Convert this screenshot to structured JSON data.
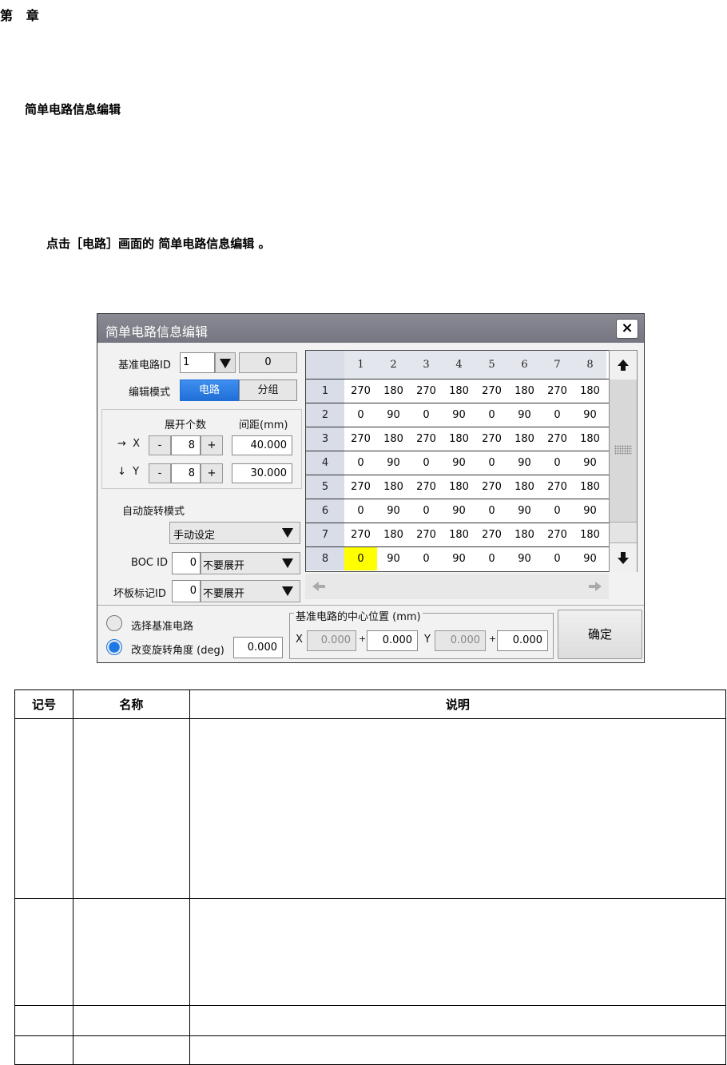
{
  "chapter": {
    "prefix": "第",
    "suffix": "章"
  },
  "section_title": "简单电路信息编辑",
  "instruction": {
    "lead": "点击［电路］画面的",
    "target": "简单电路信息编辑",
    "end": "。"
  },
  "dialog": {
    "title": "简单电路信息编辑",
    "close_symbol": "×",
    "base_circuit_label": "基准电路ID",
    "base_circuit_value": "1",
    "base_circuit_extra": "0",
    "edit_mode_label": "编辑模式",
    "edit_mode_options": [
      "电路",
      "分组"
    ],
    "expand_count_label": "展开个数",
    "spacing_label": "间距(mm)",
    "x_arrow": "→",
    "x_label": "X",
    "x_count": "8",
    "x_spacing": "40.000",
    "y_arrow": "↓",
    "y_label": "Y",
    "y_count": "8",
    "y_spacing": "30.000",
    "minus": "-",
    "plus": "+",
    "auto_rotate_label": "自动旋转模式",
    "auto_rotate_value": "手动设定",
    "boc_label": "BOC ID",
    "boc_value": "0",
    "boc_option": "不要展开",
    "bad_mark_label": "坏板标记ID",
    "bad_mark_value": "0",
    "bad_mark_option": "不要展开",
    "radio_select_base": "选择基准电路",
    "radio_change_angle": "改变旋转角度 (deg)",
    "angle_value": "0.000",
    "center_group_label": "基准电路的中心位置 (mm)",
    "center_x_label": "X",
    "center_x_base": "0.000",
    "center_x_offset": "0.000",
    "center_y_label": "Y",
    "center_y_base": "0.000",
    "center_y_offset": "0.000",
    "plus_small": "+",
    "confirm_label": "确定",
    "grid": {
      "columns": [
        "1",
        "2",
        "3",
        "4",
        "5",
        "6",
        "7",
        "8"
      ],
      "rows": [
        {
          "label": "1",
          "cells": [
            "270",
            "180",
            "270",
            "180",
            "270",
            "180",
            "270",
            "180"
          ]
        },
        {
          "label": "2",
          "cells": [
            "0",
            "90",
            "0",
            "90",
            "0",
            "90",
            "0",
            "90"
          ]
        },
        {
          "label": "3",
          "cells": [
            "270",
            "180",
            "270",
            "180",
            "270",
            "180",
            "270",
            "180"
          ]
        },
        {
          "label": "4",
          "cells": [
            "0",
            "90",
            "0",
            "90",
            "0",
            "90",
            "0",
            "90"
          ]
        },
        {
          "label": "5",
          "cells": [
            "270",
            "180",
            "270",
            "180",
            "270",
            "180",
            "270",
            "180"
          ]
        },
        {
          "label": "6",
          "cells": [
            "0",
            "90",
            "0",
            "90",
            "0",
            "90",
            "0",
            "90"
          ]
        },
        {
          "label": "7",
          "cells": [
            "270",
            "180",
            "270",
            "180",
            "270",
            "180",
            "270",
            "180"
          ]
        },
        {
          "label": "8",
          "cells": [
            "0",
            "90",
            "0",
            "90",
            "0",
            "90",
            "0",
            "90"
          ]
        }
      ],
      "highlight_color": "#ffff00"
    }
  },
  "table": {
    "headers": [
      "记号",
      "名称",
      "说明"
    ]
  },
  "colors": {
    "title_bar": "#7e7f8a",
    "accent_blue": "#1f6fd8",
    "row_header": "#d8dde8",
    "highlight": "#ffff00"
  }
}
